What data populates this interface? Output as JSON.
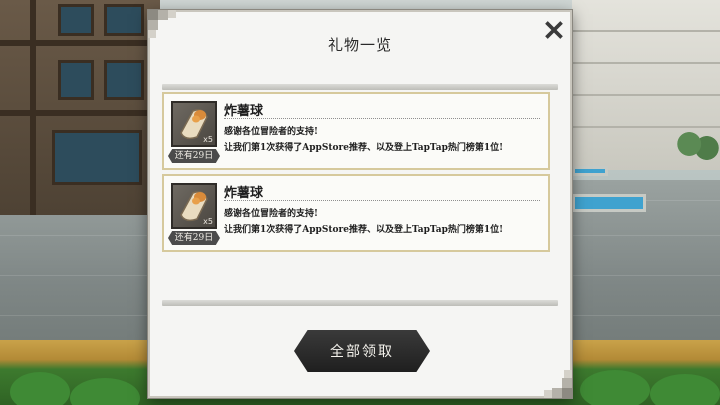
{
  "dialog": {
    "title": "礼物一览",
    "close_icon": "close-icon",
    "claim_all_label": "全部领取"
  },
  "gifts": [
    {
      "icon": "fries-icon",
      "name": "炸薯球",
      "quantity": "x5",
      "expiry": "还有29日",
      "line1": "感谢各位冒险者的支持!",
      "line2": "让我们第1次获得了AppStore推荐、以及登上TapTap热门榜第1位!"
    },
    {
      "icon": "fries-icon",
      "name": "炸薯球",
      "quantity": "x5",
      "expiry": "还有29日",
      "line1": "感谢各位冒险者的支持!",
      "line2": "让我们第1次获得了AppStore推荐、以及登上TapTap热门榜第1位!"
    }
  ],
  "colors": {
    "accent_border": "#d6c99c",
    "button_bg": "#2b2b2b",
    "badge_bg": "#4b4b4b"
  }
}
